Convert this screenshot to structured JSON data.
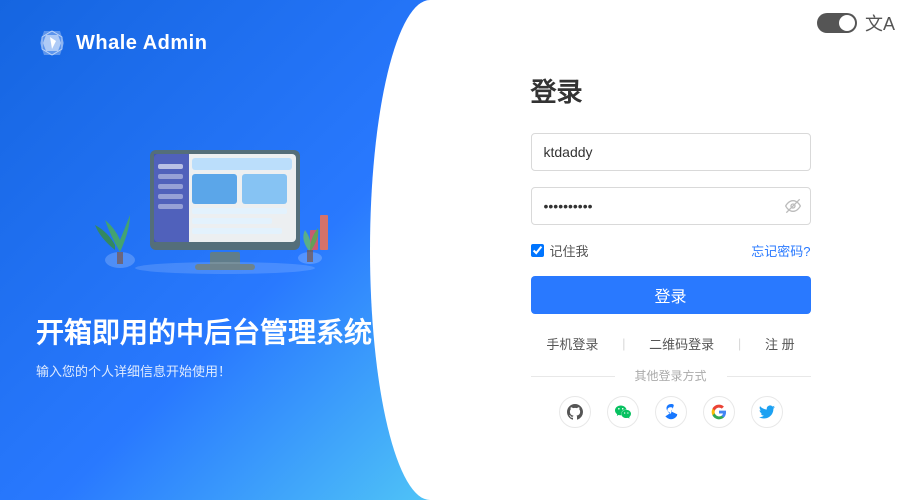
{
  "app": {
    "name": "Whale Admin"
  },
  "left": {
    "hero_title": "开箱即用的中后台管理系统",
    "hero_subtitle": "输入您的个人详细信息开始使用！"
  },
  "form": {
    "title": "登录",
    "username_placeholder": "ktdaddy",
    "username_value": "ktdaddy",
    "password_placeholder": "••••••••••",
    "remember_label": "记住我",
    "forgot_label": "忘记密码?",
    "login_button": "登录",
    "alt_methods": {
      "phone": "手机登录",
      "qr": "二维码登录",
      "register": "注 册"
    },
    "other_label": "其他登录方式"
  },
  "icons": {
    "github": "⊙",
    "wechat": "◉",
    "alipay": "◎",
    "google": "◌",
    "twitter": "◍"
  },
  "topbar": {
    "toggle_state": "dark",
    "lang_icon": "文A"
  }
}
